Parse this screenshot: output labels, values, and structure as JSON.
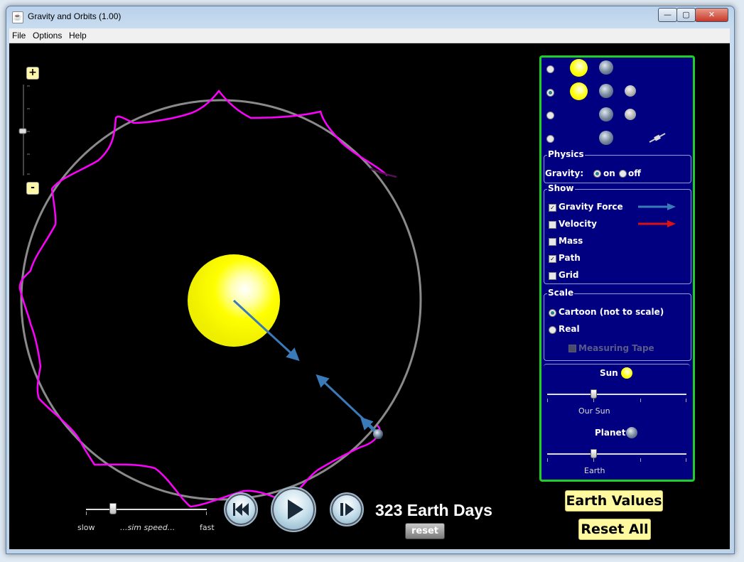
{
  "window": {
    "title": "Gravity and Orbits (1.00)",
    "app_icon": "java-icon",
    "min": "—",
    "max": "▢",
    "close": "✕"
  },
  "menu": {
    "file": "File",
    "options": "Options",
    "help": "Help"
  },
  "zoom": {
    "plus": "+",
    "minus": "-"
  },
  "presets": [
    {
      "selected": false,
      "bodies": [
        "sun",
        "earth"
      ]
    },
    {
      "selected": true,
      "bodies": [
        "sun",
        "earth",
        "moon"
      ]
    },
    {
      "selected": false,
      "bodies": [
        "earth",
        "moon"
      ]
    },
    {
      "selected": false,
      "bodies": [
        "earth",
        "satellite"
      ]
    }
  ],
  "physics": {
    "title": "Physics",
    "gravity_label": "Gravity:",
    "on": "on",
    "off": "off",
    "gravity_on": true
  },
  "show": {
    "title": "Show",
    "gravity_force": {
      "label": "Gravity Force",
      "checked": true,
      "arrow_color": "#3a7ab8"
    },
    "velocity": {
      "label": "Velocity",
      "checked": false,
      "arrow_color": "#dd1111"
    },
    "mass": {
      "label": "Mass",
      "checked": false
    },
    "path": {
      "label": "Path",
      "checked": true
    },
    "grid": {
      "label": "Grid",
      "checked": false
    }
  },
  "scale": {
    "title": "Scale",
    "cartoon": "Cartoon (not to scale)",
    "real": "Real",
    "measuring_tape": "Measuring Tape",
    "cartoon_selected": true
  },
  "sun_section": {
    "label": "Sun",
    "slider_label": "Our Sun"
  },
  "planet_section": {
    "label": "Planet",
    "slider_label": "Earth"
  },
  "buttons": {
    "earth_values": "Earth Values",
    "reset_all": "Reset All",
    "reset": "reset"
  },
  "speed": {
    "slow": "slow",
    "label": "...sim speed...",
    "fast": "fast"
  },
  "time": {
    "display": "323 Earth Days"
  },
  "colors": {
    "panel_bg": "#000080",
    "panel_border": "#20d020",
    "path": "#ff00ff",
    "orbit": "#8a8a8a",
    "sun": "#ffff00",
    "force_arrow": "#3a7ab8"
  }
}
